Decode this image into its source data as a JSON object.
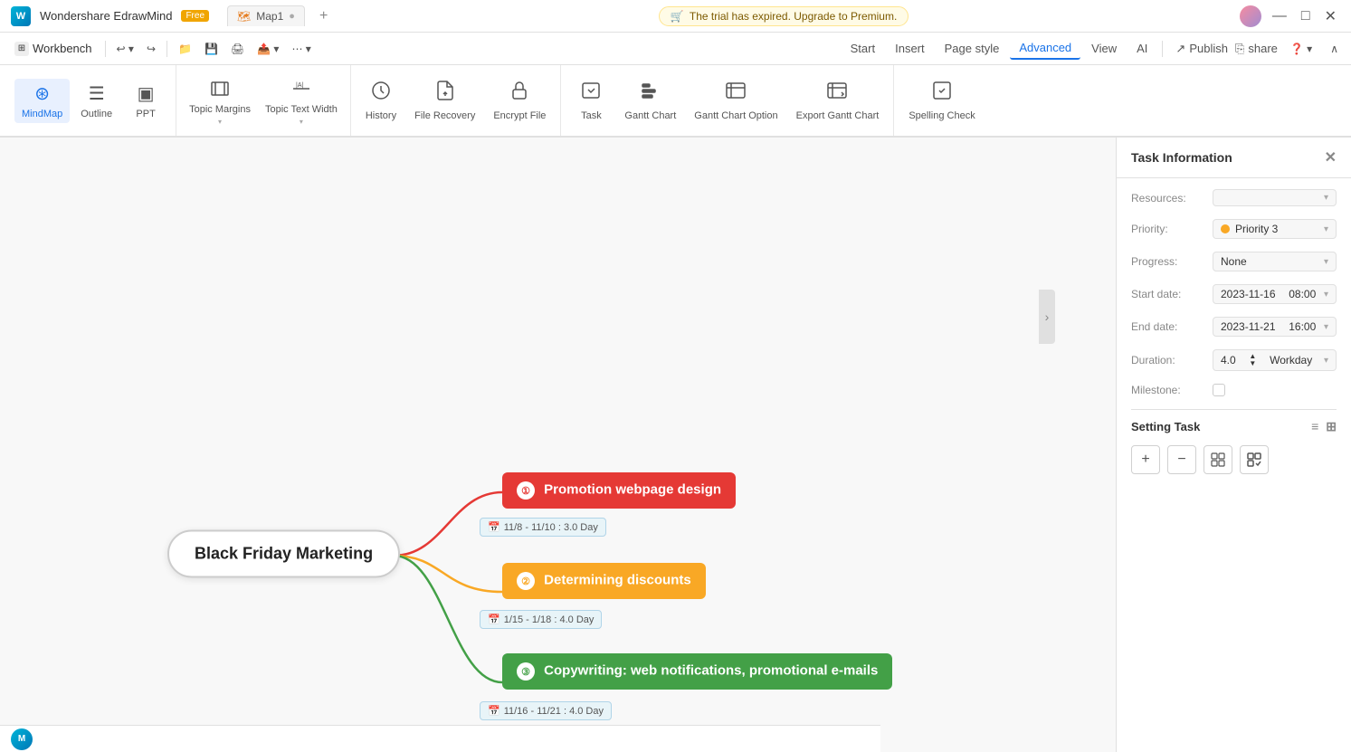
{
  "titlebar": {
    "app_name": "Wondershare EdrawMind",
    "free_label": "Free",
    "tab_name": "Map1",
    "trial_text": "The trial has expired. Upgrade to Premium.",
    "minimize": "—",
    "maximize": "□",
    "close": "✕"
  },
  "menubar": {
    "workbench": "Workbench",
    "nav": [
      "Start",
      "Insert",
      "Page style",
      "Advanced",
      "View",
      "AI"
    ],
    "active_nav": "Advanced",
    "publish": "Publish",
    "share": "share"
  },
  "ribbon": {
    "groups": [
      {
        "items": [
          {
            "id": "mindmap",
            "label": "MindMap",
            "active": true
          },
          {
            "id": "outline",
            "label": "Outline",
            "active": false
          },
          {
            "id": "ppt",
            "label": "PPT",
            "active": false
          }
        ]
      },
      {
        "items": [
          {
            "id": "topic-margins",
            "label": "Topic Margins",
            "active": false
          },
          {
            "id": "topic-text-width",
            "label": "Topic Text Width",
            "active": false
          }
        ]
      },
      {
        "items": [
          {
            "id": "history",
            "label": "History",
            "active": false
          },
          {
            "id": "file-recovery",
            "label": "File Recovery",
            "active": false
          },
          {
            "id": "encrypt-file",
            "label": "Encrypt File",
            "active": false
          }
        ]
      },
      {
        "items": [
          {
            "id": "task",
            "label": "Task",
            "active": false
          },
          {
            "id": "gantt-chart",
            "label": "Gantt Chart",
            "active": false
          },
          {
            "id": "gantt-chart-option",
            "label": "Gantt Chart Option",
            "active": false
          },
          {
            "id": "export-gantt-chart",
            "label": "Export Gantt Chart",
            "active": false
          }
        ]
      },
      {
        "items": [
          {
            "id": "spelling-check",
            "label": "Spelling Check",
            "active": false
          }
        ]
      }
    ]
  },
  "canvas": {
    "central_node": "Black Friday Marketing",
    "tasks": [
      {
        "id": "task1",
        "label": "Promotion webpage design",
        "color": "red",
        "badge": "①",
        "date_range": "11/8 - 11/10 : 3.0 Day"
      },
      {
        "id": "task2",
        "label": "Determining discounts",
        "color": "orange",
        "badge": "②",
        "date_range": "1/15 - 1/18 : 4.0 Day"
      },
      {
        "id": "task3",
        "label": "Copywriting: web notifications, promotional e-mails",
        "color": "green",
        "badge": "③",
        "date_range": "11/16 - 11/21 : 4.0 Day"
      }
    ]
  },
  "task_panel": {
    "title": "Task Information",
    "fields": {
      "resources_label": "Resources:",
      "resources_value": "",
      "priority_label": "Priority:",
      "priority_value": "Priority 3",
      "progress_label": "Progress:",
      "progress_value": "None",
      "start_date_label": "Start date:",
      "start_date_value": "2023-11-16",
      "start_time_value": "08:00",
      "end_date_label": "End date:",
      "end_date_value": "2023-11-21",
      "end_time_value": "16:00",
      "duration_label": "Duration:",
      "duration_value": "4.0",
      "duration_unit": "Workday",
      "milestone_label": "Milestone:"
    },
    "setting_task_label": "Setting Task"
  }
}
